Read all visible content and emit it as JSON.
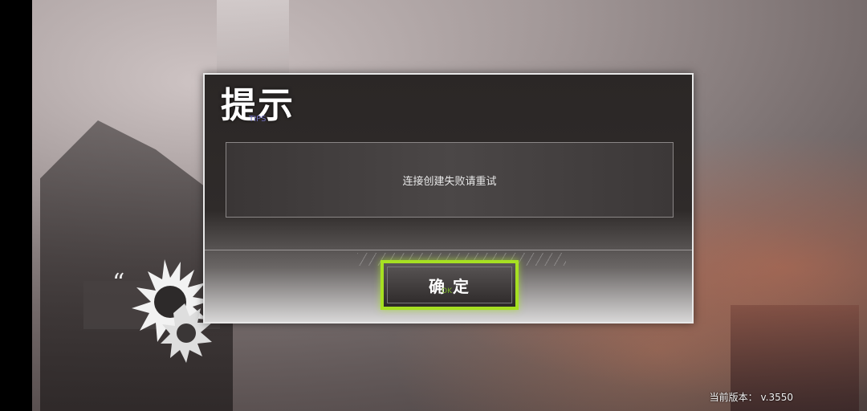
{
  "dialog": {
    "title": "提示",
    "subtitle": "TIPS",
    "message": "连接创建失败请重试",
    "confirm_label": "确定",
    "confirm_sub": "OK"
  },
  "footer": {
    "version": "当前版本： v.3550"
  },
  "colors": {
    "button_border": "#a6e022",
    "dialog_bg": "#2b2726"
  },
  "icons": {
    "quote": "quote-icon",
    "burst": "sunburst-emblem-icon"
  }
}
